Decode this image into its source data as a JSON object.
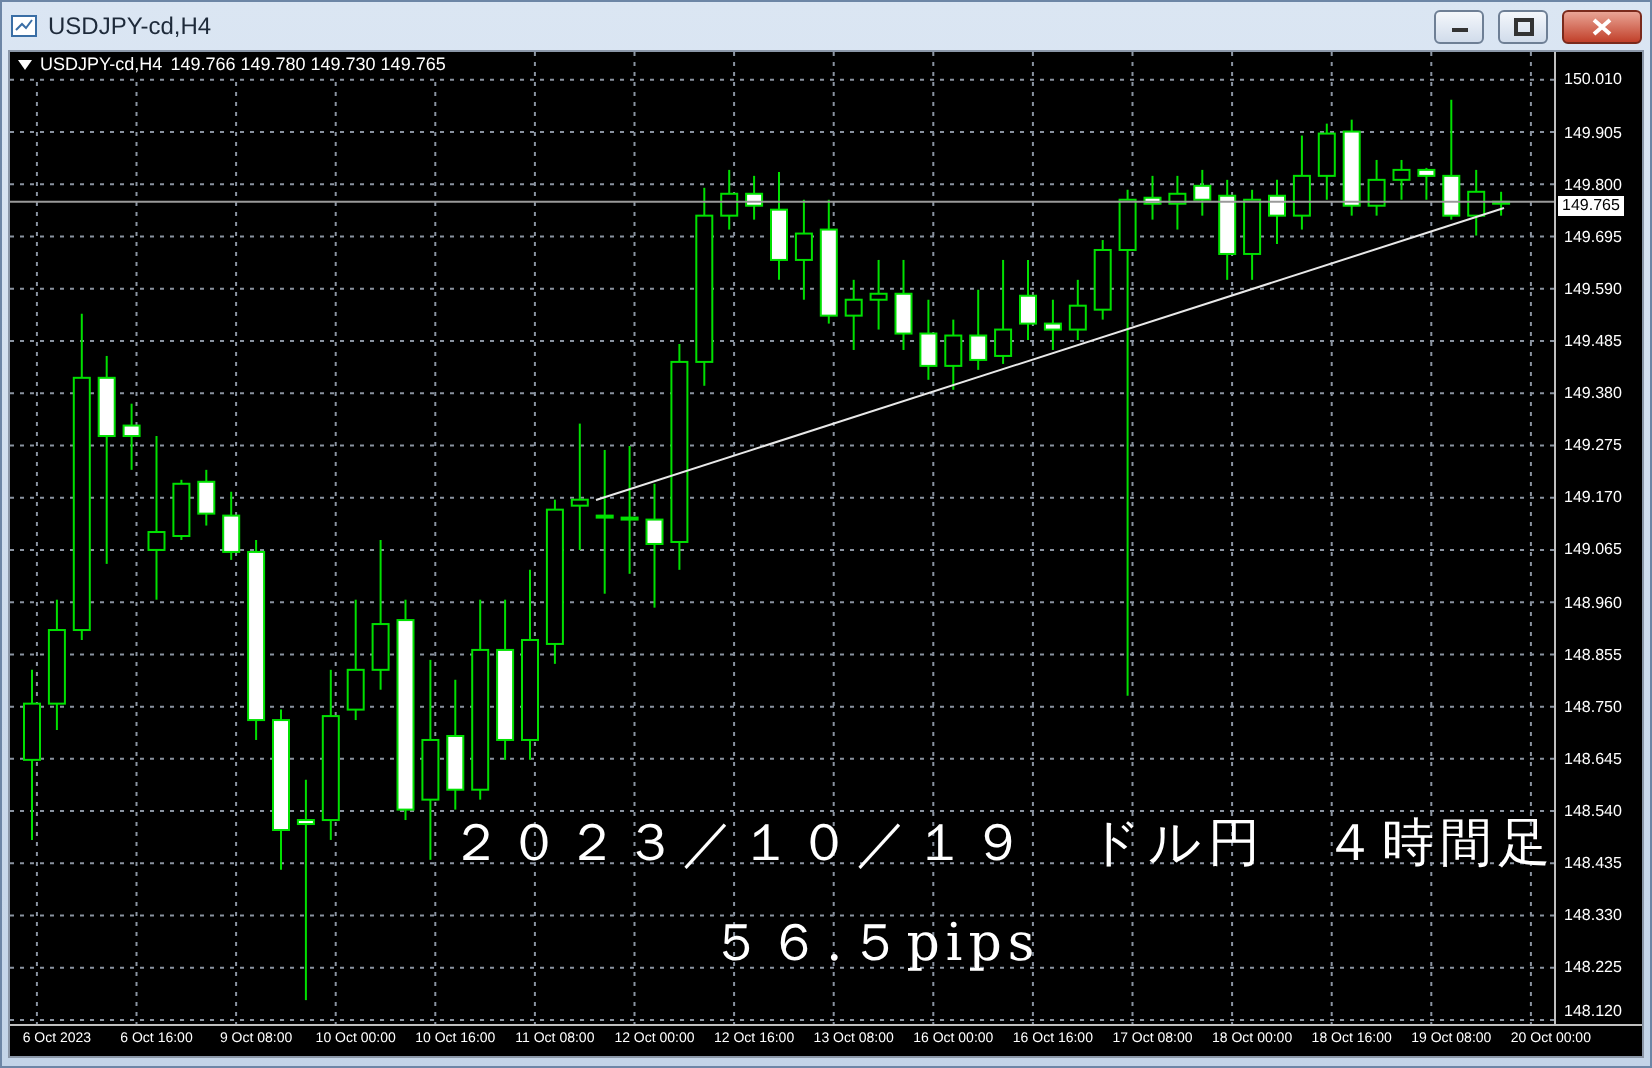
{
  "window": {
    "title": "USDJPY-cd,H4"
  },
  "chart": {
    "symbol": "USDJPY-cd,H4",
    "quote": "149.766 149.780 149.730 149.765",
    "current_price": "149.765",
    "chart_data": {
      "type": "candlestick",
      "ylim": [
        148.112,
        150.066
      ],
      "grid": true,
      "ref_lines": [
        {
          "axis": "y",
          "value": 149.765
        }
      ],
      "categories": [
        null,
        "6 Oct 2023",
        null,
        null,
        null,
        "6 Oct 16:00",
        null,
        null,
        null,
        "9 Oct 08:00",
        null,
        null,
        null,
        "10 Oct 00:00",
        null,
        null,
        null,
        "10 Oct 16:00",
        null,
        null,
        null,
        "11 Oct 08:00",
        null,
        null,
        null,
        "12 Oct 00:00",
        null,
        null,
        null,
        "12 Oct 16:00",
        null,
        null,
        null,
        "13 Oct 08:00",
        null,
        null,
        null,
        "16 Oct 00:00",
        null,
        null,
        null,
        "16 Oct 16:00",
        null,
        null,
        null,
        "17 Oct 08:00",
        null,
        null,
        null,
        "18 Oct 00:00",
        null,
        null,
        null,
        "18 Oct 16:00",
        null,
        null,
        null,
        "19 Oct 08:00",
        null,
        null,
        null,
        "20 Oct 00:00"
      ],
      "yticks": [
        {
          "value": 150.01,
          "label": "150.010"
        },
        {
          "value": 149.905,
          "label": "149.905"
        },
        {
          "value": 149.8,
          "label": "149.800"
        },
        {
          "value": 149.695,
          "label": "149.695"
        },
        {
          "value": 149.59,
          "label": "149.590"
        },
        {
          "value": 149.485,
          "label": "149.485"
        },
        {
          "value": 149.38,
          "label": "149.380"
        },
        {
          "value": 149.275,
          "label": "149.275"
        },
        {
          "value": 149.17,
          "label": "149.170"
        },
        {
          "value": 149.065,
          "label": "149.065"
        },
        {
          "value": 148.96,
          "label": "148.960"
        },
        {
          "value": 148.855,
          "label": "148.855"
        },
        {
          "value": 148.75,
          "label": "148.750"
        },
        {
          "value": 148.645,
          "label": "148.645"
        },
        {
          "value": 148.54,
          "label": "148.540"
        },
        {
          "value": 148.435,
          "label": "148.435"
        },
        {
          "value": 148.33,
          "label": "148.330"
        },
        {
          "value": 148.225,
          "label": "148.225"
        },
        {
          "value": 148.12,
          "label": "148.120"
        }
      ],
      "ohlc": [
        [
          148.643,
          148.824,
          148.482,
          148.756
        ],
        [
          148.756,
          148.965,
          148.703,
          148.904
        ],
        [
          148.904,
          149.54,
          148.884,
          149.411
        ],
        [
          149.411,
          149.455,
          149.037,
          149.294
        ],
        [
          149.315,
          149.359,
          149.226,
          149.294
        ],
        [
          149.065,
          149.294,
          148.965,
          149.101
        ],
        [
          149.093,
          149.206,
          149.085,
          149.198
        ],
        [
          149.202,
          149.226,
          149.114,
          149.138
        ],
        [
          149.134,
          149.182,
          149.045,
          149.061
        ],
        [
          149.061,
          149.085,
          148.683,
          148.723
        ],
        [
          148.723,
          148.744,
          148.422,
          148.502
        ],
        [
          148.522,
          148.603,
          148.16,
          148.514
        ],
        [
          148.522,
          148.824,
          148.482,
          148.731
        ],
        [
          148.744,
          148.965,
          148.723,
          148.824
        ],
        [
          148.824,
          149.085,
          148.784,
          148.916
        ],
        [
          148.924,
          148.965,
          148.522,
          148.543
        ],
        [
          148.563,
          148.844,
          148.442,
          148.683
        ],
        [
          148.691,
          148.804,
          148.543,
          148.583
        ],
        [
          148.583,
          148.965,
          148.563,
          148.864
        ],
        [
          148.864,
          148.965,
          148.643,
          148.683
        ],
        [
          148.683,
          149.025,
          148.643,
          148.884
        ],
        [
          148.876,
          149.166,
          148.836,
          149.146
        ],
        [
          149.154,
          149.319,
          149.065,
          149.166
        ],
        [
          149.134,
          149.266,
          148.977,
          149.13
        ],
        [
          149.13,
          149.274,
          149.017,
          149.126
        ],
        [
          149.126,
          149.198,
          148.949,
          149.077
        ],
        [
          149.081,
          149.479,
          149.025,
          149.443
        ],
        [
          149.443,
          149.793,
          149.395,
          149.737
        ],
        [
          149.737,
          149.829,
          149.709,
          149.781
        ],
        [
          149.781,
          149.817,
          149.729,
          149.757
        ],
        [
          149.749,
          149.825,
          149.608,
          149.648
        ],
        [
          149.648,
          149.769,
          149.568,
          149.701
        ],
        [
          149.709,
          149.769,
          149.52,
          149.536
        ],
        [
          149.536,
          149.608,
          149.467,
          149.568
        ],
        [
          149.568,
          149.648,
          149.508,
          149.58
        ],
        [
          149.58,
          149.648,
          149.467,
          149.5
        ],
        [
          149.5,
          149.568,
          149.407,
          149.435
        ],
        [
          149.435,
          149.528,
          149.387,
          149.496
        ],
        [
          149.496,
          149.588,
          149.427,
          149.447
        ],
        [
          149.455,
          149.648,
          149.439,
          149.508
        ],
        [
          149.576,
          149.648,
          149.487,
          149.52
        ],
        [
          149.52,
          149.568,
          149.467,
          149.508
        ],
        [
          149.508,
          149.608,
          149.487,
          149.556
        ],
        [
          149.548,
          149.688,
          149.528,
          149.668
        ],
        [
          149.668,
          149.789,
          148.772,
          149.769
        ],
        [
          149.773,
          149.817,
          149.729,
          149.761
        ],
        [
          149.761,
          149.817,
          149.709,
          149.781
        ],
        [
          149.797,
          149.829,
          149.737,
          149.769
        ],
        [
          149.777,
          149.809,
          149.608,
          149.66
        ],
        [
          149.66,
          149.789,
          149.608,
          149.769
        ],
        [
          149.777,
          149.809,
          149.68,
          149.737
        ],
        [
          149.737,
          149.898,
          149.709,
          149.817
        ],
        [
          149.817,
          149.922,
          149.769,
          149.902
        ],
        [
          149.906,
          149.93,
          149.737,
          149.757
        ],
        [
          149.757,
          149.849,
          149.737,
          149.809
        ],
        [
          149.809,
          149.849,
          149.769,
          149.829
        ],
        [
          149.829,
          149.833,
          149.769,
          149.817
        ],
        [
          149.817,
          149.97,
          149.729,
          149.737
        ],
        [
          149.737,
          149.829,
          149.697,
          149.785
        ],
        [
          149.761,
          149.785,
          149.737,
          149.765
        ],
        null,
        null
      ]
    },
    "annotations": [
      "２０２３／１０／１９　ドル円　４時間足",
      "５６.５pips"
    ]
  }
}
